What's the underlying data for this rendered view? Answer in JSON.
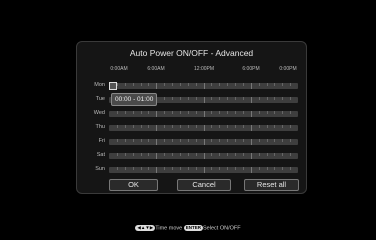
{
  "dialog": {
    "title": "Auto Power ON/OFF - Advanced",
    "time_labels": [
      "0:00AM",
      "6:00AM",
      "12:00PM",
      "6:00PM",
      "0:00PM"
    ],
    "days": [
      "Mon",
      "Tue",
      "Wed",
      "Thu",
      "Fri",
      "Sat",
      "Sun"
    ],
    "selected_day": "Mon",
    "tooltip": "00:00 - 01:00",
    "buttons": {
      "ok": "OK",
      "cancel": "Cancel",
      "reset_all": "Reset all"
    }
  },
  "hint": {
    "arrows_icon": "dpad-icon",
    "arrows_text": "Time move",
    "enter_key": "ENTER",
    "enter_text": "Select ON/OFF"
  }
}
